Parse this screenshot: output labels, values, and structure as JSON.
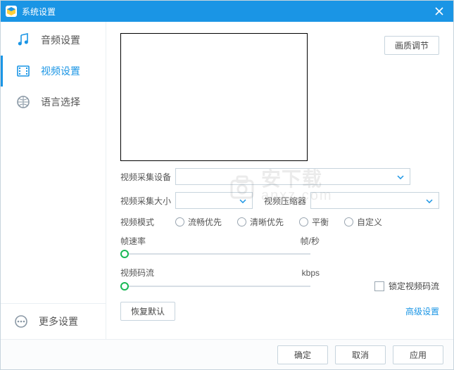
{
  "window_title": "系统设置",
  "sidebar": {
    "items": [
      {
        "label": "音频设置"
      },
      {
        "label": "视频设置"
      },
      {
        "label": "语言选择"
      }
    ],
    "more": "更多设置"
  },
  "content": {
    "quality_button": "画质调节",
    "device_label": "视频采集设备",
    "size_label": "视频采集大小",
    "compressor_label": "视频压缩器",
    "mode_label": "视频模式",
    "modes": [
      "流畅优先",
      "清晰优先",
      "平衡",
      "自定义"
    ],
    "framerate_label": "帧速率",
    "framerate_unit": "帧/秒",
    "bitrate_label": "视频码流",
    "bitrate_unit": "kbps",
    "lock_bitrate": "锁定视频码流",
    "restore_defaults": "恢复默认",
    "advanced": "高级设置"
  },
  "footer": {
    "ok": "确定",
    "cancel": "取消",
    "apply": "应用"
  },
  "watermark": {
    "line1": "安下载",
    "line2": "anxz.com"
  }
}
